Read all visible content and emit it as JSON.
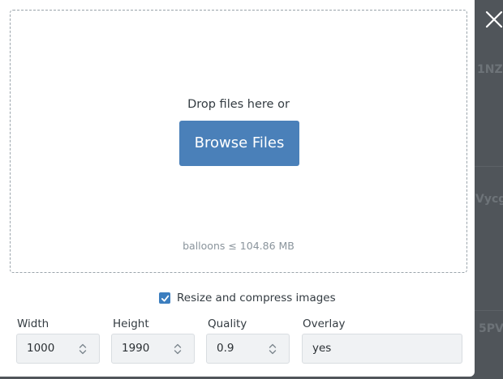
{
  "upload": {
    "drop_text": "Drop files here or",
    "browse_label": "Browse Files",
    "limit_note": "balloons ≤ 104.86 MB"
  },
  "resize": {
    "checked": true,
    "label": "Resize and compress images"
  },
  "fields": {
    "width": {
      "label": "Width",
      "value": "1000"
    },
    "height": {
      "label": "Height",
      "value": "1990"
    },
    "quality": {
      "label": "Quality",
      "value": "0.9"
    },
    "overlay": {
      "label": "Overlay",
      "value": "yes"
    }
  },
  "background": {
    "fragments": [
      "1NZ",
      "Vycg",
      "5PV"
    ]
  },
  "colors": {
    "accent": "#4a80b9",
    "checkbox": "#3c7ebf",
    "backdrop": "#50555a"
  },
  "icons": {
    "close": "close-icon",
    "check": "check-icon",
    "spinner": "chevron-up-down-icon"
  }
}
